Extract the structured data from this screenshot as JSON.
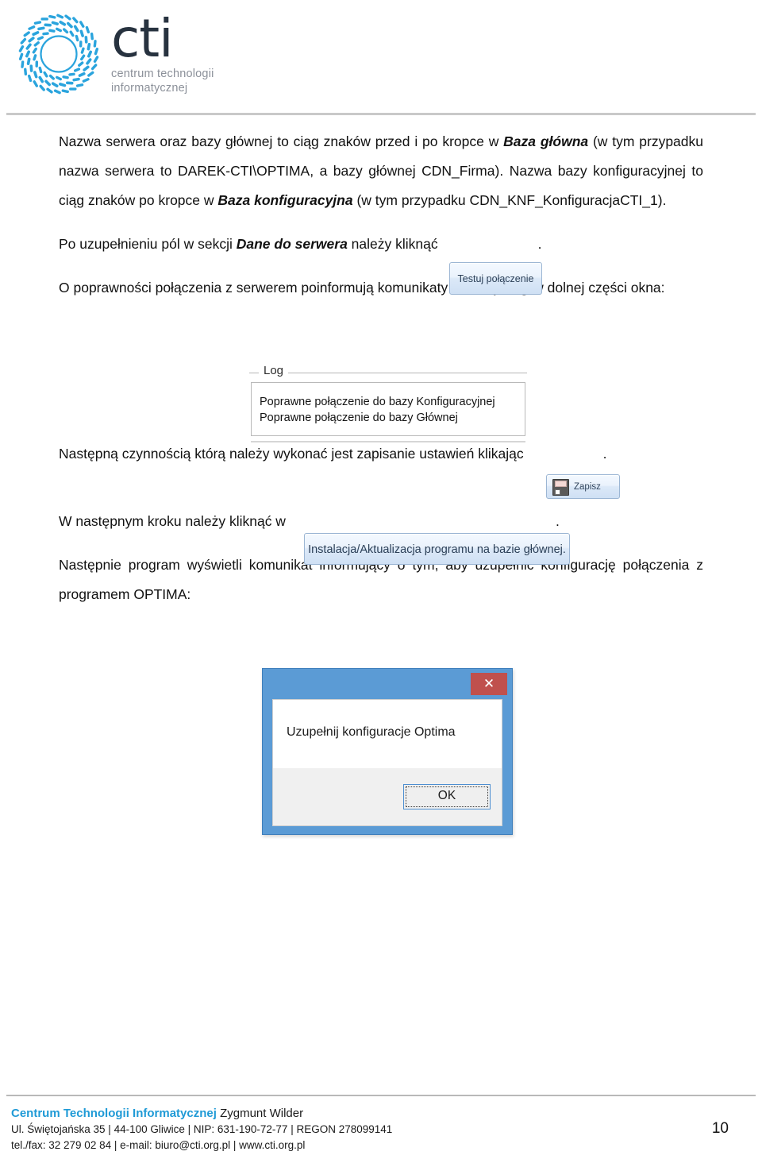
{
  "header": {
    "logo_wordmark": "cti",
    "logo_tagline_line1": "centrum technologii",
    "logo_tagline_line2": "informatycznej",
    "logo_icon_name": "cti-radial-logo",
    "logo_color": "#2aa4dd",
    "wordmark_color": "#27323f"
  },
  "body": {
    "p1_a": "Nazwa serwera oraz bazy głównej to ciąg znaków przed i po kropce w ",
    "p1_b": "Baza główna",
    "p1_c": " (w tym przypadku nazwa serwera to DAREK-CTI\\OPTIMA, a bazy głównej CDN_Firma). Nazwa bazy konfiguracyjnej to ciąg znaków po kropce w ",
    "p1_d": "Baza konfiguracyjna",
    "p1_e": " (w tym przypadku CDN_KNF_KonfiguracjaCTI_1).",
    "p2_a": "Po uzupełnieniu pól w sekcji ",
    "p2_b": "Dane do serwera",
    "p2_c": " należy kliknąć",
    "p2_d": ".",
    "p3_a": "O poprawności połączenia z serwerem poinformują komunikaty w sekcji ",
    "p3_b": "Log",
    "p3_c": " w dolnej części okna:",
    "p4_a": "Następną czynnością którą należy wykonać jest zapisanie ustawień klikając",
    "p4_b": ".",
    "p5_a": "W następnym kroku należy kliknąć w",
    "p5_b": ".",
    "p6": "Następnie program wyświetli komunikat informujący o tym, aby uzupełnić konfigurację połączenia z programem OPTIMA:"
  },
  "screenshots": {
    "test_button_label": "Testuj połączenie",
    "save_button_label": "Zapisz",
    "save_button_icon": "floppy-disk-icon",
    "install_button_label": "Instalacja/Aktualizacja programu na bazie głównej.",
    "log_group": {
      "legend": "Log",
      "lines": [
        "Poprawne połączenie do bazy Konfiguracyjnej",
        "Poprawne połączenie do bazy Głównej"
      ]
    },
    "dialog": {
      "close_label": "✕",
      "close_icon": "close-icon",
      "message": "Uzupełnij konfiguracje Optima",
      "ok_label": "OK",
      "titlebar_color": "#5b9bd5",
      "close_color": "#c0504d"
    }
  },
  "footer": {
    "company_brand": "Centrum Technologii Informatycznej",
    "company_owner": " Zygmunt Wilder",
    "address_line": "Ul. Świętojańska 35  |  44-100 Gliwice  |  NIP: 631-190-72-77  |  REGON 278099141",
    "contact_line": "tel./fax: 32 279 02 84  |  e-mail: biuro@cti.org.pl  |  www.cti.org.pl",
    "page_number": "10",
    "brand_color": "#1f9ad6"
  }
}
